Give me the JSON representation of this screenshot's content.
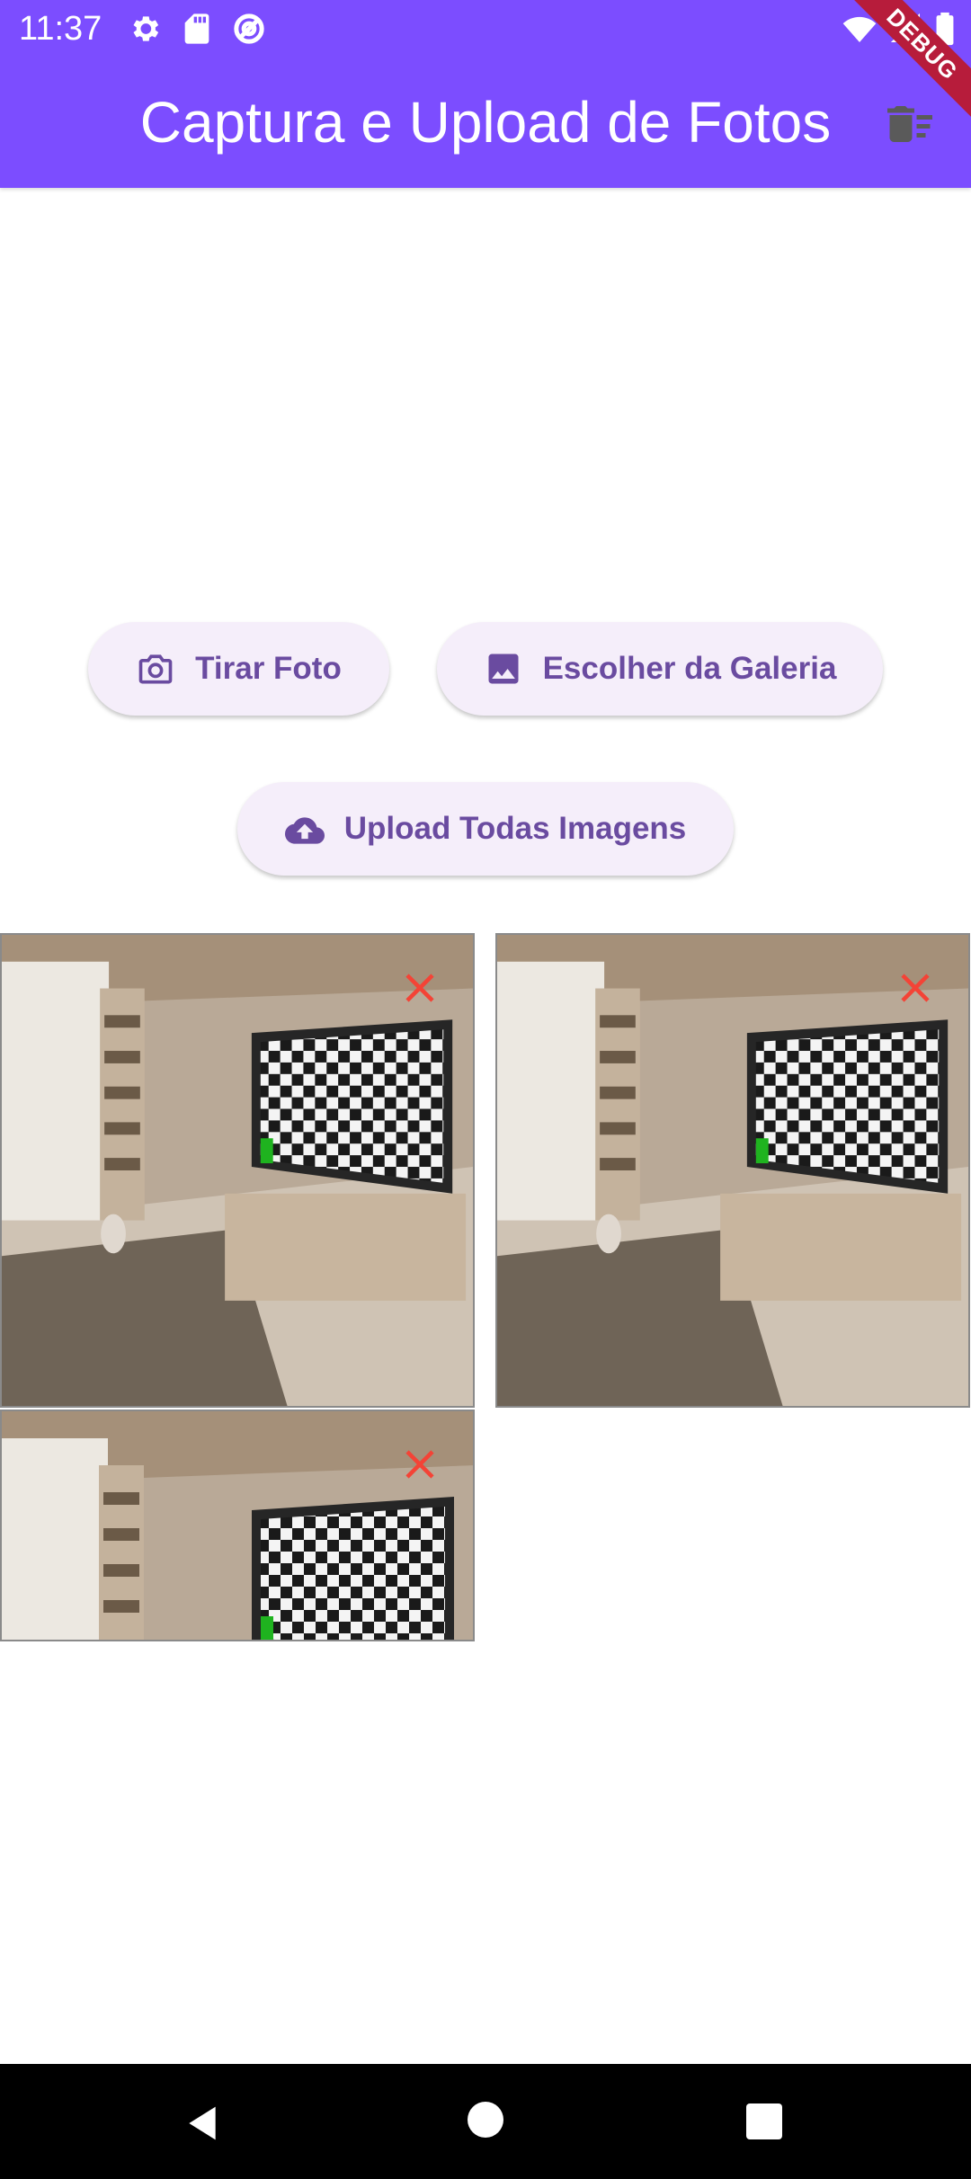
{
  "status_bar": {
    "time": "11:37",
    "left_icons": [
      "settings-icon",
      "sd-card-icon",
      "vpn-icon"
    ],
    "right_icons": [
      "wifi-icon",
      "signal-icon",
      "battery-icon"
    ]
  },
  "app_bar": {
    "title": "Captura e Upload de Fotos",
    "action_icon": "delete-sweep-icon",
    "debug_banner": "DEBUG",
    "color": "#7c4dff"
  },
  "buttons": {
    "take_photo": {
      "label": "Tirar Foto",
      "icon": "camera-icon"
    },
    "gallery": {
      "label": "Escolher da Galeria",
      "icon": "image-icon"
    },
    "upload_all": {
      "label": "Upload Todas Imagens",
      "icon": "cloud-upload-icon"
    },
    "accent": "#6a4ba0",
    "background": "#f5eefa"
  },
  "images": [
    {
      "remove_icon": "close-icon",
      "remove_color": "#f44336"
    },
    {
      "remove_icon": "close-icon",
      "remove_color": "#f44336"
    },
    {
      "remove_icon": "close-icon",
      "remove_color": "#f44336"
    }
  ],
  "nav_bar": {
    "icons": [
      "back-icon",
      "home-icon",
      "recents-icon"
    ]
  }
}
